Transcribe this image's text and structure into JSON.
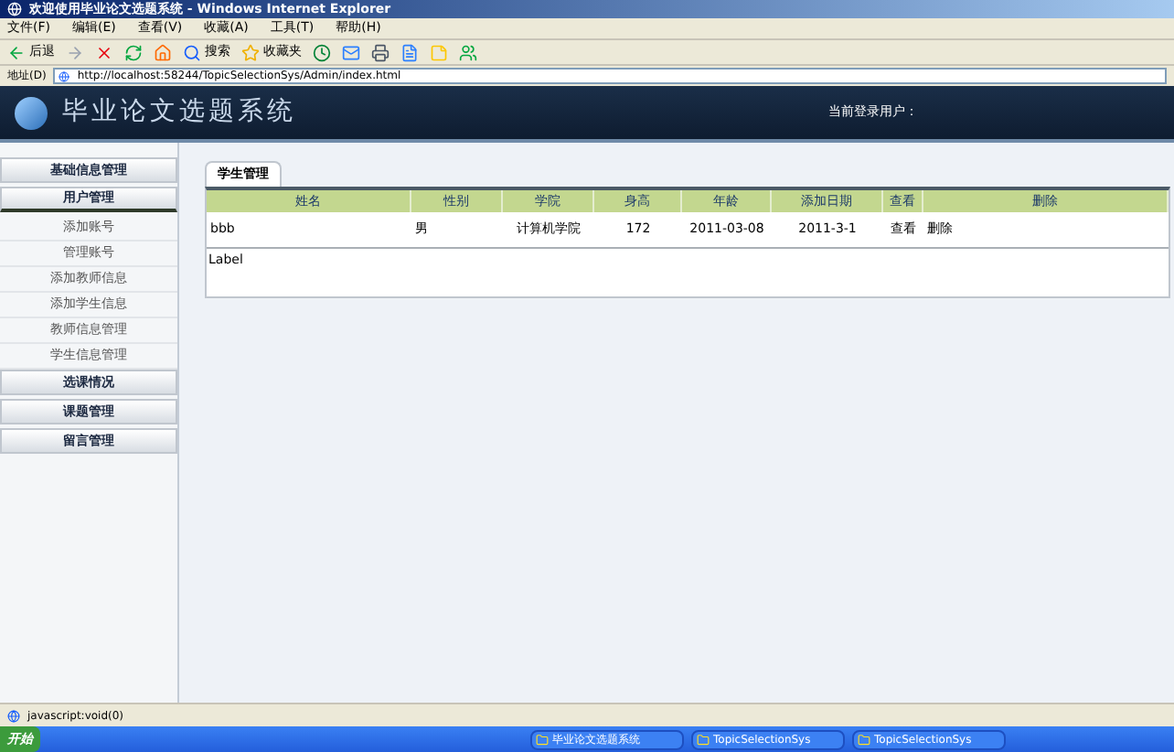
{
  "window": {
    "title": "欢迎使用毕业论文选题系统 - Windows Internet Explorer"
  },
  "menu": [
    "文件(F)",
    "编辑(E)",
    "查看(V)",
    "收藏(A)",
    "工具(T)",
    "帮助(H)"
  ],
  "toolbar": [
    {
      "kind": "back",
      "label": "后退"
    },
    {
      "kind": "forward"
    },
    {
      "kind": "stop"
    },
    {
      "kind": "refresh"
    },
    {
      "kind": "home"
    },
    {
      "kind": "search",
      "label": "搜索"
    },
    {
      "kind": "favorites",
      "label": "收藏夹"
    },
    {
      "kind": "history"
    },
    {
      "kind": "mail"
    },
    {
      "kind": "print"
    },
    {
      "kind": "edit"
    },
    {
      "kind": "note"
    },
    {
      "kind": "messenger"
    }
  ],
  "address": {
    "label": "地址(D)",
    "value": "http://localhost:58244/TopicSelectionSys/Admin/index.html"
  },
  "header": {
    "logo": "毕业论文选题系统",
    "user_label": "当前登录用户："
  },
  "sidebar": [
    {
      "label": "基础信息管理",
      "expanded": false
    },
    {
      "label": "用户管理",
      "expanded": true,
      "children": [
        {
          "label": "添加账号"
        },
        {
          "label": "管理账号"
        },
        {
          "label": "添加教师信息"
        },
        {
          "label": "添加学生信息"
        },
        {
          "label": "教师信息管理"
        },
        {
          "label": "学生信息管理"
        }
      ]
    },
    {
      "label": "选课情况",
      "expanded": false
    },
    {
      "label": "课题管理",
      "expanded": false
    },
    {
      "label": "留言管理",
      "expanded": false
    }
  ],
  "tab": {
    "label": "学生管理"
  },
  "table": {
    "columns": [
      "姓名",
      "性别",
      "学院",
      "身高",
      "年龄",
      "添加日期",
      "查看",
      "删除"
    ],
    "rows": [
      {
        "cells": [
          "bbb",
          "男",
          "计算机学院",
          "172",
          "2011-03-08",
          "2011-3-1"
        ],
        "view": "查看",
        "delete": "删除"
      }
    ]
  },
  "footer_label": "Label",
  "status_bar": "javascript:void(0)",
  "taskbar": {
    "start": "开始",
    "tasks": [
      "毕业论文选题系统",
      "TopicSelectionSys",
      "TopicSelectionSys"
    ]
  }
}
